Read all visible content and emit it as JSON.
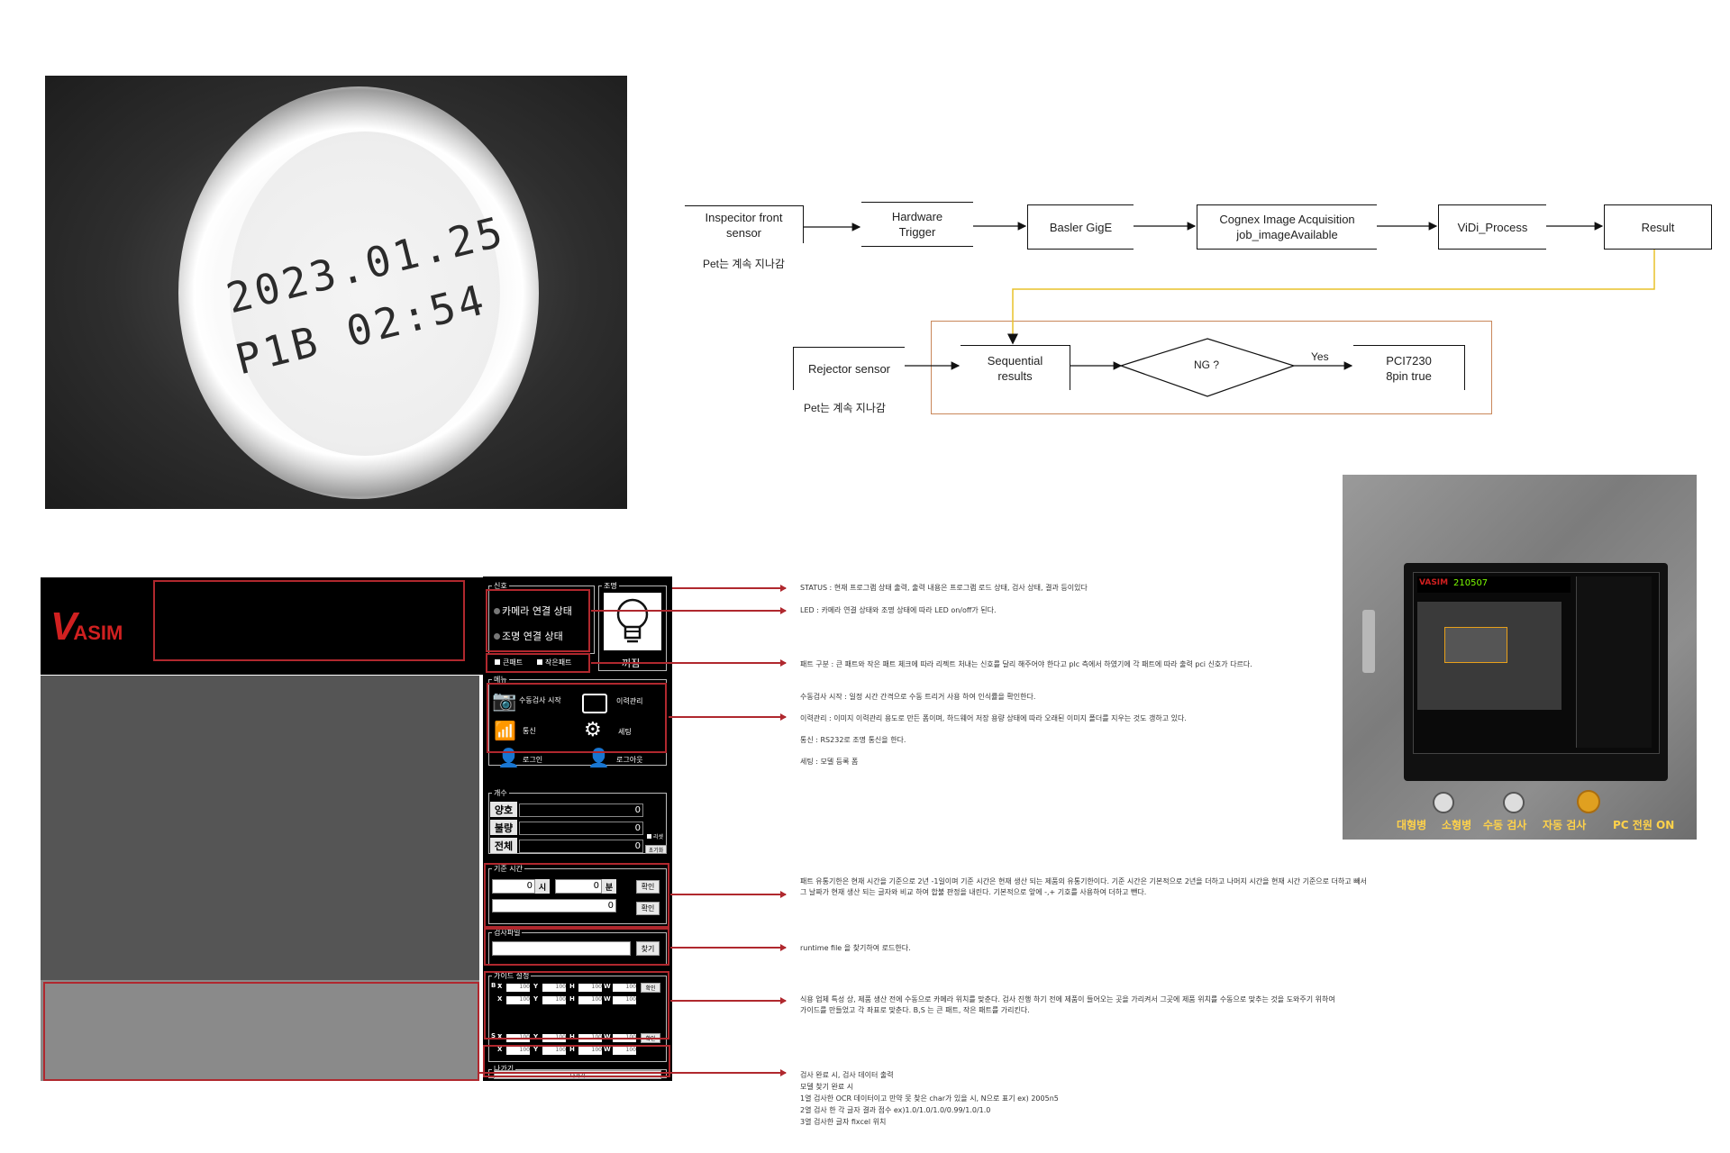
{
  "photo": {
    "stamp_line1": "2023.01.25",
    "stamp_line2": "P1B  02:54"
  },
  "flow": {
    "n1": "Inspecitor front\nsensor",
    "n1_note": "Pet는 계속 지나감",
    "n2": "Hardware\nTrigger",
    "n3": "Basler GigE",
    "n4": "Cognex Image Acquisition\njob_imageAvailable",
    "n5": "ViDi_Process",
    "n6": "Result",
    "r1": "Rejector sensor",
    "r1_note": "Pet는 계속 지나감",
    "r2": "Sequential\nresults",
    "r3": "NG ?",
    "yes": "Yes",
    "r4": "PCI7230\n8pin true"
  },
  "app": {
    "logo_v": "V",
    "logo_rest": "ASIM",
    "status": {
      "group": "신호",
      "camera": "카메라 연결 상태",
      "light": "조명 연결 상태",
      "big_pellet": "큰패트",
      "small_pellet": "작은패트"
    },
    "lighting": {
      "group": "조명",
      "state": "꺼짐"
    },
    "menu": {
      "group": "메뉴",
      "manual": "수동검사 시작",
      "history": "이력관리",
      "comm": "통신",
      "settings": "세팅",
      "login": "로그인",
      "logout": "로그아웃"
    },
    "count": {
      "group": "개수",
      "good": "양호",
      "good_val": "0",
      "bad": "불량",
      "bad_val": "0",
      "total": "전체",
      "total_val": "0",
      "reset_chk": "리셋",
      "reset_btn": "초기화"
    },
    "time": {
      "group": "기준 시간",
      "hour_val": "0",
      "hour_lbl": "시",
      "min_val": "0",
      "min_lbl": "분",
      "ok1": "확인",
      "result_val": "0",
      "ok2": "확인"
    },
    "file": {
      "group": "검사파일",
      "find": "찾기"
    },
    "guide": {
      "group": "가이드 설정",
      "b": "B :",
      "s": "S :",
      "x": "X",
      "y": "Y",
      "h": "H",
      "w": "W",
      "val": "100",
      "ok": "확인"
    },
    "exit": {
      "group": "나가기",
      "btn": "나가기"
    }
  },
  "notes": {
    "n1": "STATUS : 현재 프로그램 상태 출력, 출력 내용은 프로그램 로드 상태, 검사 상태, 결과 등이있다",
    "n2": "LED : 카메라 연결 상태와 조명 상태에 따라 LED on/off가 된다.",
    "n3": "패트 구분 : 큰 패트와 작은 패트 체크에 따라 리젝트 처내는 신호를 달리 해주어야 한다고 plc 측에서 하였기에 각 패트에 따라 출력 pci 신호가 다르다.",
    "n4": "수동검사 시작 : 일정 시간 간격으로 수동 트리거 사용 하여 인식률을 확인한다.",
    "n5": "이력관리 : 이미지 이력관리 용도로 만든 폼이며, 하드웨어 저장 용량 상태에 따라 오래된 이미지 폴더를 지우는 것도 갱하고 있다.",
    "n6": "통신 : RS232로 조명 통신을 한다.",
    "n7": "세팅 : 모델 등록 폼",
    "n8a": "패트 유통기한은 현재 시간을 기준으로 2년 -1일이며 기준 시간은 현재 생산 되는 제품의 유통기한이다. 기준 시간은 기본적으로 2년을 더하고 나머지 시간을 현재 시간 기준으로 더하고 빼서",
    "n8b": "그 날짜가 현재 생산 되는 글자와 비교 하여 합불 판정을 내린다. 기본적으로 앞에 -,+ 기호를 사용하여 더하고 뺀다.",
    "n9": "runtime file 을 찾기하여 로드한다.",
    "n10a": "식용 업체 특성 상, 제품 생산 전에 수동으로 카메라 위치를 맞춘다. 검사 진행 하기 전에 제품이 들어오는 곳을 가리켜서 그곳에 제품 위치를 수동으로 맞추는 것을 도와주기 위하여",
    "n10b": "가이드를 만들었고 각 좌표로 맞춘다. B,S 는 큰 패트, 작은 패트를 가리킨다.",
    "n11a": "검사 완료 시, 검사 데이터 출력",
    "n11b": "모델 찾기 완료 시",
    "n11c": "1열 검사한 OCR 데이터이고 만약 못 찾은 char가 있을 시, N으로 표기 ex) 2005n5",
    "n11d": "2열 검사 한 각 글자 결과 점수  ex)1.0/1.0/1.0/0.99/1.0/1.0",
    "n11e": "3열 검사한 글자 fixcel 위치"
  },
  "machine": {
    "screen_title": "210507",
    "bottom_1": "대형병",
    "bottom_2": "소형병",
    "bottom_3": "수동 검사",
    "bottom_4": "자동 검사",
    "bottom_5": "PC 전원 ON"
  },
  "colors": {
    "accent_red": "#b0282e",
    "flow_yellow": "#e8c22a",
    "logo_red": "#d02020"
  }
}
